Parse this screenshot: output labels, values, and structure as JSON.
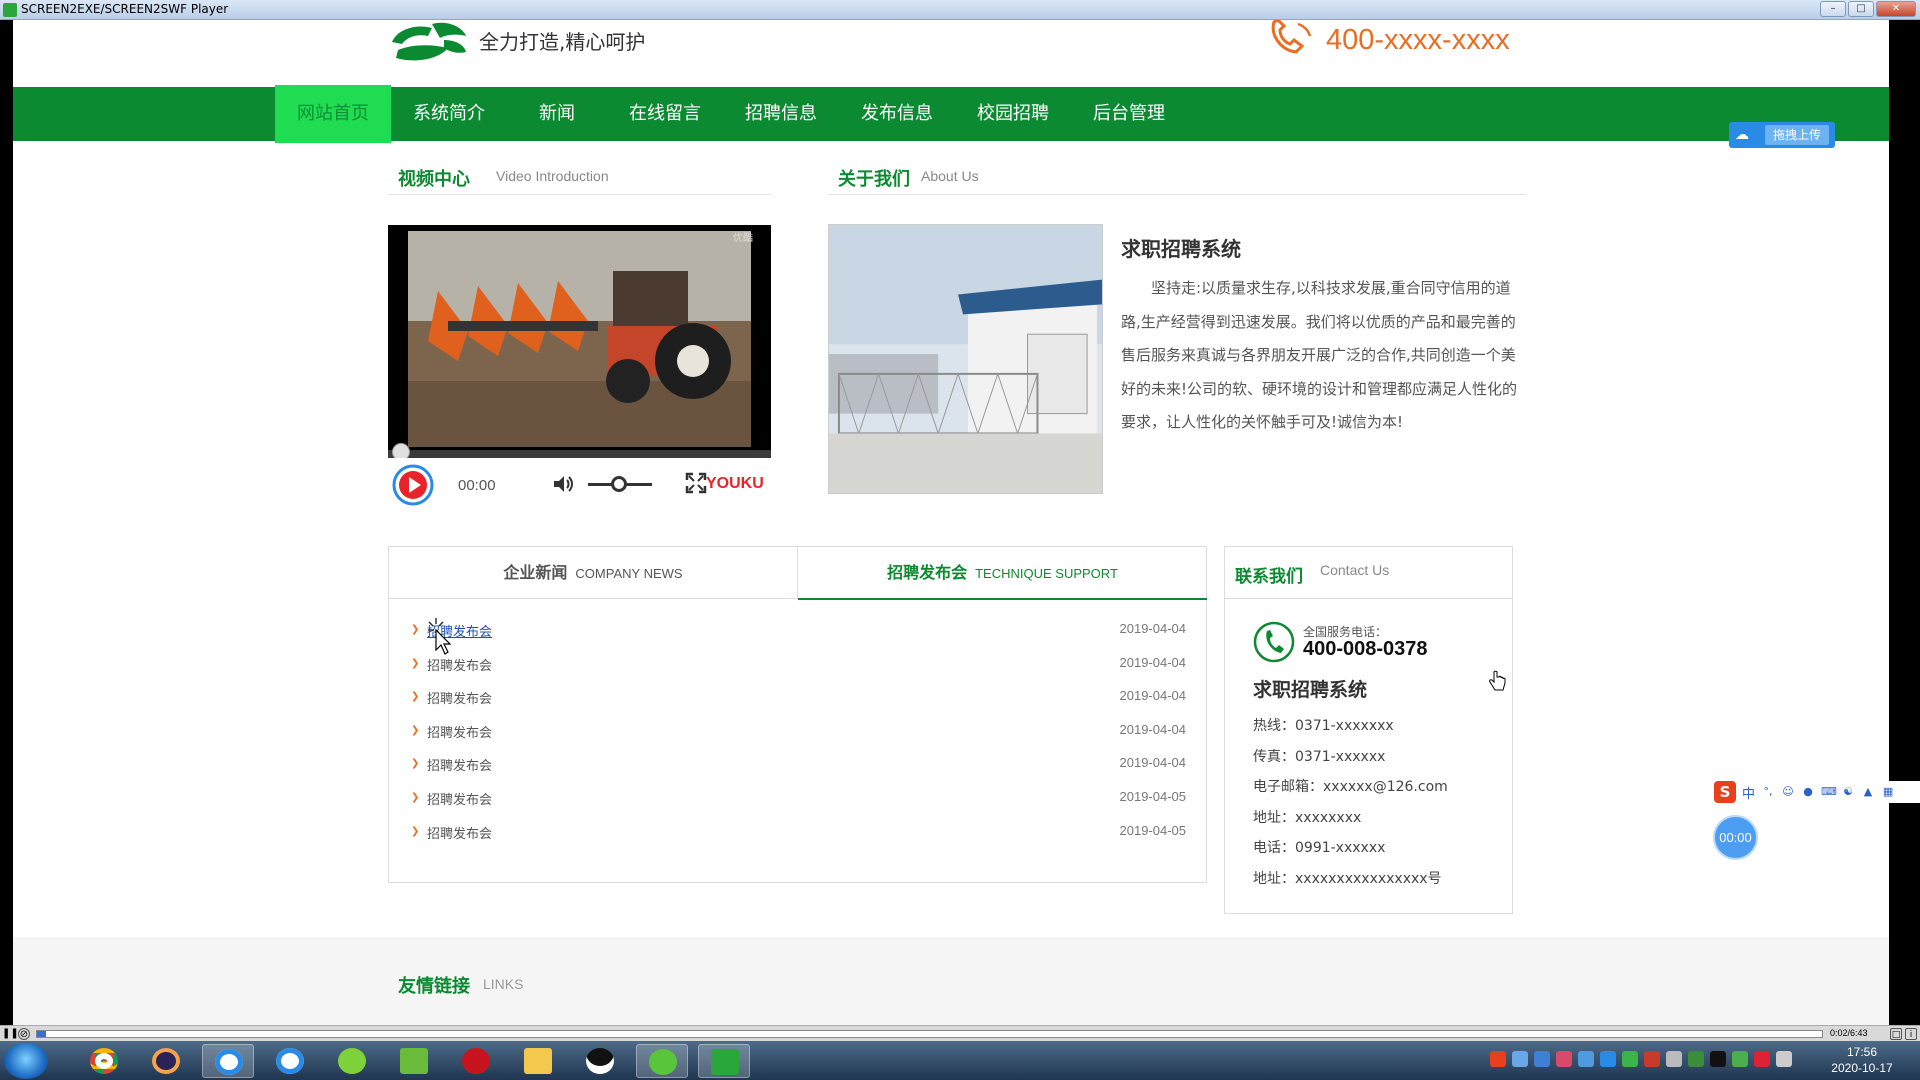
{
  "window": {
    "title": "SCREEN2EXE/SCREEN2SWF Player",
    "btn_min": "–",
    "btn_max": "□",
    "btn_close": "✕"
  },
  "header": {
    "slogan": "全力打造,精心呵护",
    "phone": "400-xxxx-xxxx"
  },
  "nav": {
    "items": [
      "网站首页",
      "系统简介",
      "新闻",
      "在线留言",
      "招聘信息",
      "发布信息",
      "校园招聘",
      "后台管理"
    ],
    "active_index": 0
  },
  "upload_badge": {
    "label": "拖拽上传"
  },
  "video_section": {
    "title_cn": "视频中心",
    "title_en": "Video Introduction",
    "watermark": "优酷",
    "time": "00:00",
    "brand": "YOUKU"
  },
  "about_section": {
    "title_cn": "关于我们",
    "title_en": "About Us",
    "heading": "求职招聘系统",
    "text": "坚持走:以质量求生存,以科技求发展,重合同守信用的道路,生产经营得到迅速发展。我们将以优质的产品和最完善的售后服务来真诚与各界朋友开展广泛的合作,共同创造一个美好的未来!公司的软、硬环境的设计和管理都应满足人性化的要求，让人性化的关怀触手可及!诚信为本!"
  },
  "news_box": {
    "tab1": {
      "cn": "企业新闻",
      "en": "COMPANY NEWS"
    },
    "tab2": {
      "cn": "招聘发布会",
      "en": "TECHNIQUE SUPPORT"
    },
    "items": [
      {
        "title": "招聘发布会",
        "date": "2019-04-04"
      },
      {
        "title": "招聘发布会",
        "date": "2019-04-04"
      },
      {
        "title": "招聘发布会",
        "date": "2019-04-04"
      },
      {
        "title": "招聘发布会",
        "date": "2019-04-04"
      },
      {
        "title": "招聘发布会",
        "date": "2019-04-04"
      },
      {
        "title": "招聘发布会",
        "date": "2019-04-05"
      },
      {
        "title": "招聘发布会",
        "date": "2019-04-05"
      }
    ]
  },
  "contact": {
    "title_cn": "联系我们",
    "title_en": "Contact Us",
    "label": "全国服务电话：",
    "hotline": "400-008-0378",
    "name": "求职招聘系统",
    "lines": [
      "热线：0371-xxxxxxx",
      "传真：0371-xxxxxx",
      "电子邮箱：xxxxxx@126.com",
      "地址：xxxxxxxx",
      "电话：0991-xxxxxx",
      "地址：xxxxxxxxxxxxxxxx号"
    ]
  },
  "links_section": {
    "title_cn": "友情链接",
    "title_en": "LINKS"
  },
  "ime": {
    "logo": "S",
    "mode": "中",
    "punct": "°,"
  },
  "timer_bubble": "00:00",
  "seekbar": {
    "time": "0:02/6:43",
    "progress": 0.005
  },
  "taskbar": {
    "time": "17:56",
    "date": "2020-10-17"
  },
  "colors": {
    "brand_green": "#0c8a32",
    "nav_active": "#1fdc52",
    "accent_orange": "#e96d22"
  }
}
